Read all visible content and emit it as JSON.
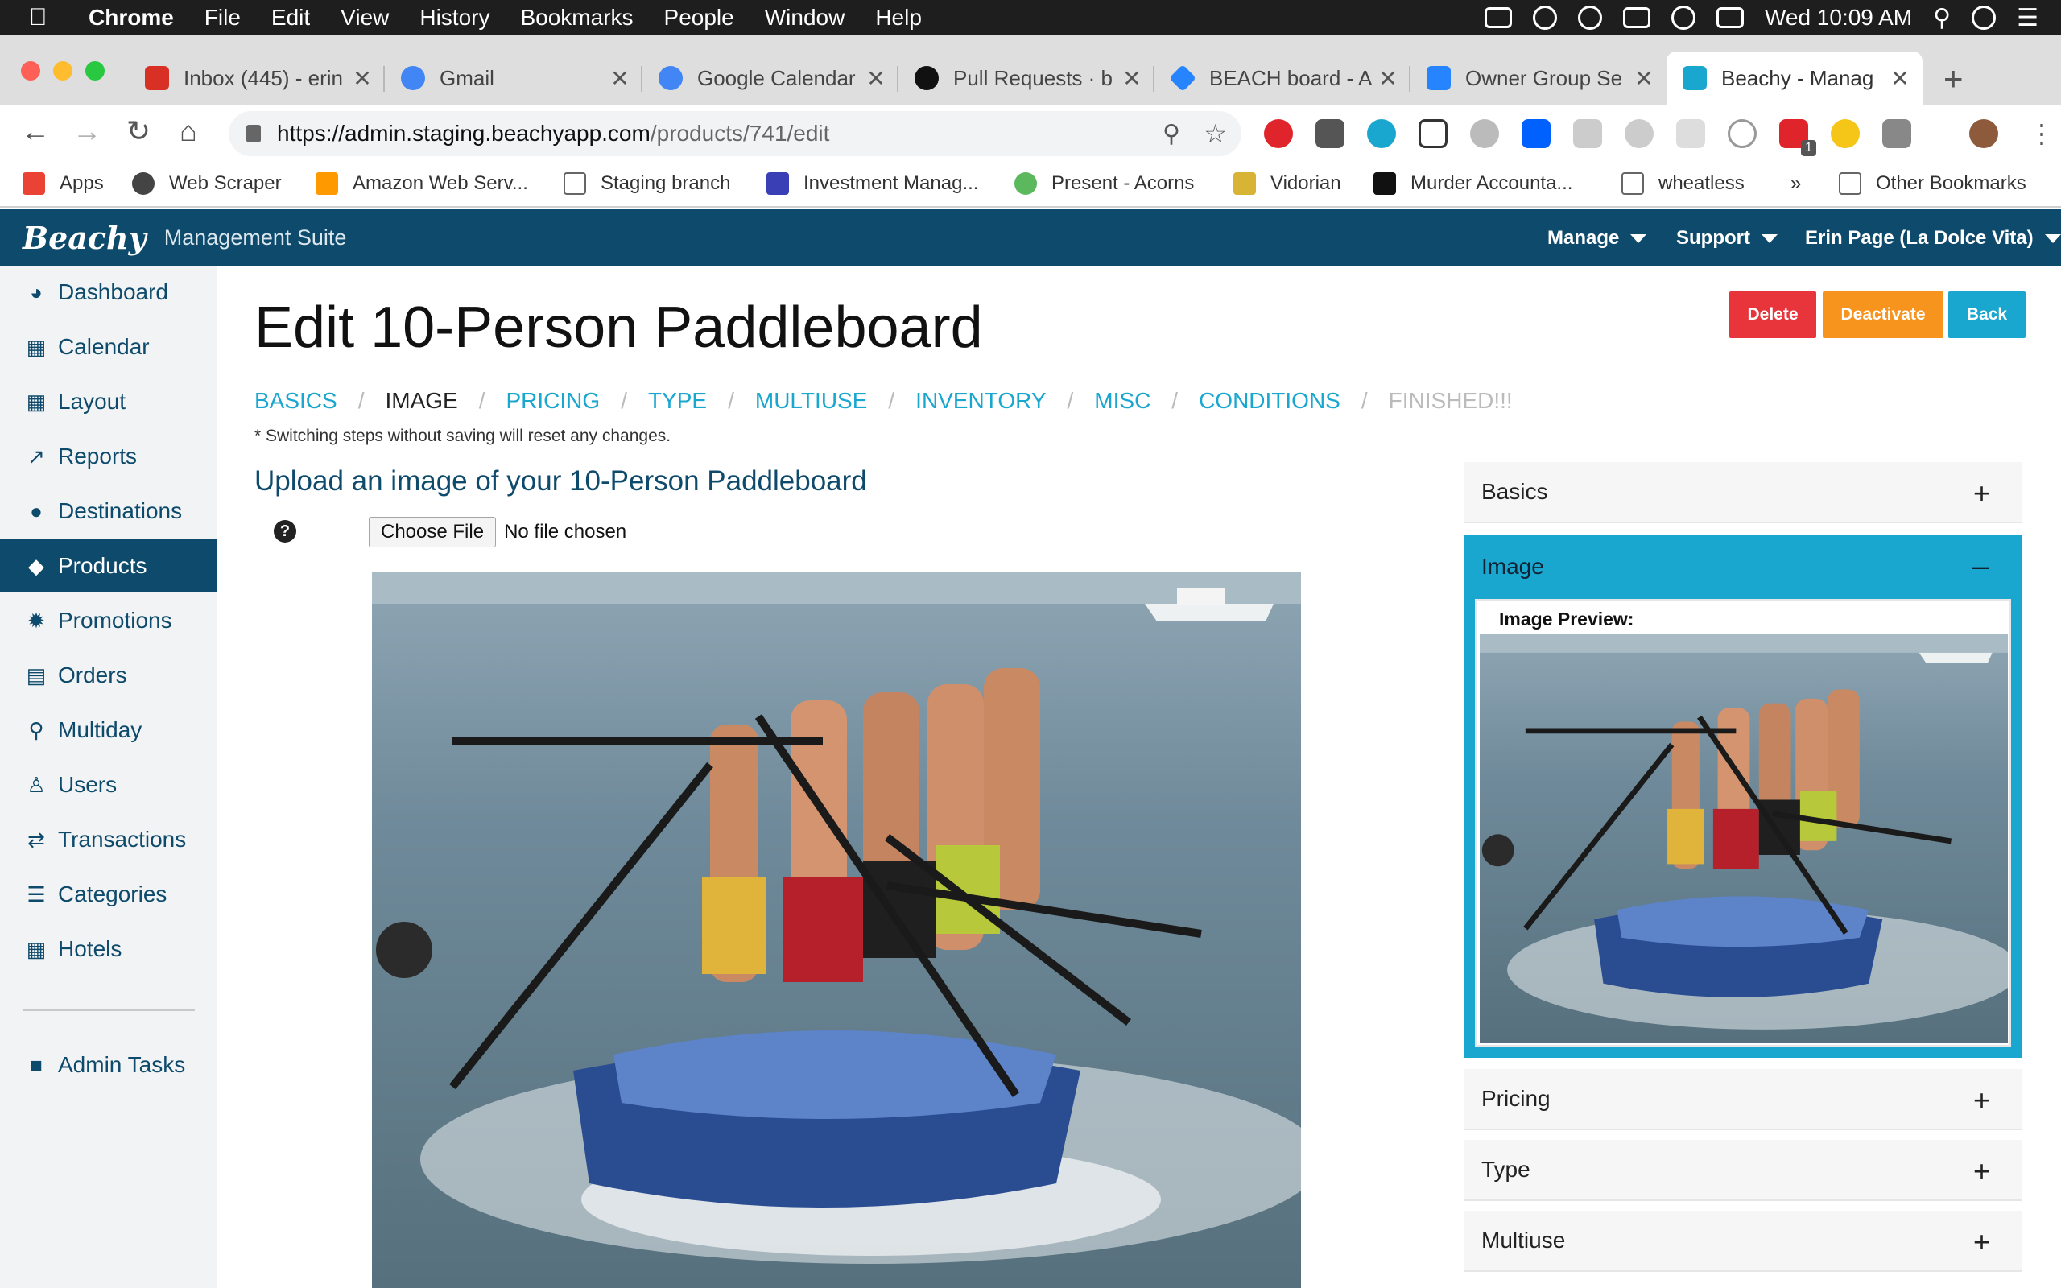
{
  "menubar": {
    "app": "Chrome",
    "items": [
      "File",
      "Edit",
      "View",
      "History",
      "Bookmarks",
      "People",
      "Window",
      "Help"
    ],
    "clock": "Wed 10:09 AM"
  },
  "tabs": [
    {
      "title": "Inbox (445) - erin",
      "color": "#d93025"
    },
    {
      "title": "Gmail",
      "color": "#4285f4"
    },
    {
      "title": "Google Calendar",
      "color": "#4285f4"
    },
    {
      "title": "Pull Requests · b",
      "color": "#111111"
    },
    {
      "title": "BEACH board - A",
      "color": "#2684ff"
    },
    {
      "title": "Owner Group Se",
      "color": "#2684ff"
    },
    {
      "title": "Beachy - Manag",
      "color": "#1aa7cf"
    }
  ],
  "toolbar": {
    "url_host": "https://admin.staging.beachyapp.com",
    "url_path": "/products/741/edit",
    "badge": "1"
  },
  "bookmarks": [
    {
      "label": "Apps"
    },
    {
      "label": "Web Scraper"
    },
    {
      "label": "Amazon Web Serv..."
    },
    {
      "label": "Staging branch"
    },
    {
      "label": "Investment Manag..."
    },
    {
      "label": "Present - Acorns"
    },
    {
      "label": "Vidorian"
    },
    {
      "label": "Murder Accounta..."
    },
    {
      "label": "wheatless"
    },
    {
      "label": "»"
    },
    {
      "label": "Other Bookmarks"
    }
  ],
  "header": {
    "logo": "Beachy",
    "suite": "Management Suite",
    "menus": [
      "Manage",
      "Support",
      "Erin Page (La Dolce Vita)"
    ]
  },
  "sidebar": {
    "items": [
      {
        "label": "Dashboard",
        "icon": "dashboard-icon"
      },
      {
        "label": "Calendar",
        "icon": "calendar-icon"
      },
      {
        "label": "Layout",
        "icon": "grid-icon"
      },
      {
        "label": "Reports",
        "icon": "chart-line-icon"
      },
      {
        "label": "Destinations",
        "icon": "map-pin-icon"
      },
      {
        "label": "Products",
        "icon": "tag-icon",
        "active": true
      },
      {
        "label": "Promotions",
        "icon": "badge-icon"
      },
      {
        "label": "Orders",
        "icon": "credit-card-icon"
      },
      {
        "label": "Multiday",
        "icon": "search-icon"
      },
      {
        "label": "Users",
        "icon": "user-icon"
      },
      {
        "label": "Transactions",
        "icon": "exchange-icon"
      },
      {
        "label": "Categories",
        "icon": "list-icon"
      },
      {
        "label": "Hotels",
        "icon": "building-icon"
      }
    ],
    "admin": {
      "label": "Admin Tasks",
      "icon": "lock-icon"
    }
  },
  "main": {
    "title": "Edit 10-Person Paddleboard",
    "buttons": {
      "delete": "Delete",
      "deactivate": "Deactivate",
      "back": "Back"
    },
    "steps": [
      "BASICS",
      "IMAGE",
      "PRICING",
      "TYPE",
      "MULTIUSE",
      "INVENTORY",
      "MISC",
      "CONDITIONS",
      "FINISHED!!!"
    ],
    "current_step": "IMAGE",
    "step_note": "* Switching steps without saving will reset any changes.",
    "upload_heading": "Upload an image of your 10-Person Paddleboard",
    "help": "?",
    "choose_file": "Choose File",
    "no_file": "No file chosen"
  },
  "accordion": {
    "basics": "Basics",
    "image": "Image",
    "image_preview_label": "Image Preview:",
    "pricing": "Pricing",
    "type": "Type",
    "multiuse": "Multiuse",
    "plus": "+",
    "minus": "–"
  },
  "colors": {
    "brand": "#0e4a6b",
    "accent": "#1aa7cf",
    "delete": "#e8343b",
    "deactivate": "#f7941e",
    "back": "#1aa7cf"
  }
}
